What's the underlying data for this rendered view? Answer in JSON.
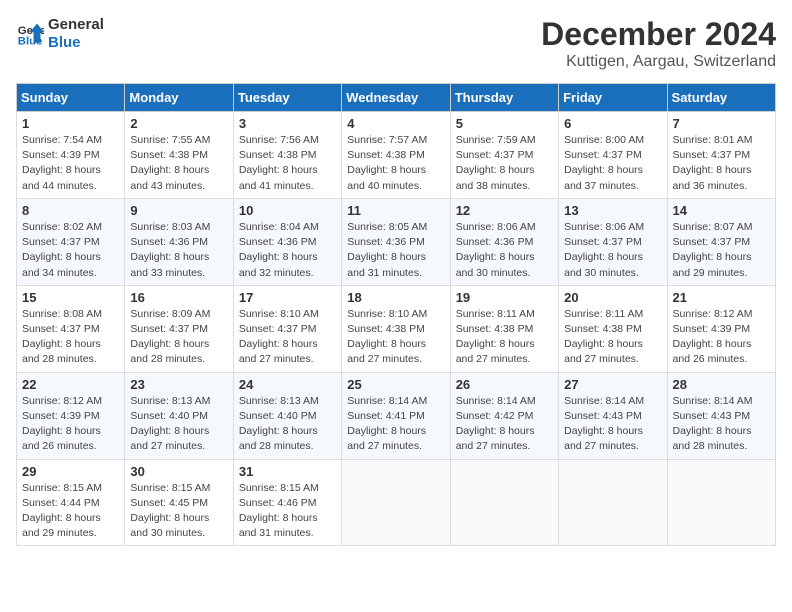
{
  "header": {
    "logo_line1": "General",
    "logo_line2": "Blue",
    "month_title": "December 2024",
    "location": "Kuttigen, Aargau, Switzerland"
  },
  "days_of_week": [
    "Sunday",
    "Monday",
    "Tuesday",
    "Wednesday",
    "Thursday",
    "Friday",
    "Saturday"
  ],
  "weeks": [
    [
      {
        "day": "1",
        "sunrise": "7:54 AM",
        "sunset": "4:39 PM",
        "daylight": "8 hours and 44 minutes."
      },
      {
        "day": "2",
        "sunrise": "7:55 AM",
        "sunset": "4:38 PM",
        "daylight": "8 hours and 43 minutes."
      },
      {
        "day": "3",
        "sunrise": "7:56 AM",
        "sunset": "4:38 PM",
        "daylight": "8 hours and 41 minutes."
      },
      {
        "day": "4",
        "sunrise": "7:57 AM",
        "sunset": "4:38 PM",
        "daylight": "8 hours and 40 minutes."
      },
      {
        "day": "5",
        "sunrise": "7:59 AM",
        "sunset": "4:37 PM",
        "daylight": "8 hours and 38 minutes."
      },
      {
        "day": "6",
        "sunrise": "8:00 AM",
        "sunset": "4:37 PM",
        "daylight": "8 hours and 37 minutes."
      },
      {
        "day": "7",
        "sunrise": "8:01 AM",
        "sunset": "4:37 PM",
        "daylight": "8 hours and 36 minutes."
      }
    ],
    [
      {
        "day": "8",
        "sunrise": "8:02 AM",
        "sunset": "4:37 PM",
        "daylight": "8 hours and 34 minutes."
      },
      {
        "day": "9",
        "sunrise": "8:03 AM",
        "sunset": "4:36 PM",
        "daylight": "8 hours and 33 minutes."
      },
      {
        "day": "10",
        "sunrise": "8:04 AM",
        "sunset": "4:36 PM",
        "daylight": "8 hours and 32 minutes."
      },
      {
        "day": "11",
        "sunrise": "8:05 AM",
        "sunset": "4:36 PM",
        "daylight": "8 hours and 31 minutes."
      },
      {
        "day": "12",
        "sunrise": "8:06 AM",
        "sunset": "4:36 PM",
        "daylight": "8 hours and 30 minutes."
      },
      {
        "day": "13",
        "sunrise": "8:06 AM",
        "sunset": "4:37 PM",
        "daylight": "8 hours and 30 minutes."
      },
      {
        "day": "14",
        "sunrise": "8:07 AM",
        "sunset": "4:37 PM",
        "daylight": "8 hours and 29 minutes."
      }
    ],
    [
      {
        "day": "15",
        "sunrise": "8:08 AM",
        "sunset": "4:37 PM",
        "daylight": "8 hours and 28 minutes."
      },
      {
        "day": "16",
        "sunrise": "8:09 AM",
        "sunset": "4:37 PM",
        "daylight": "8 hours and 28 minutes."
      },
      {
        "day": "17",
        "sunrise": "8:10 AM",
        "sunset": "4:37 PM",
        "daylight": "8 hours and 27 minutes."
      },
      {
        "day": "18",
        "sunrise": "8:10 AM",
        "sunset": "4:38 PM",
        "daylight": "8 hours and 27 minutes."
      },
      {
        "day": "19",
        "sunrise": "8:11 AM",
        "sunset": "4:38 PM",
        "daylight": "8 hours and 27 minutes."
      },
      {
        "day": "20",
        "sunrise": "8:11 AM",
        "sunset": "4:38 PM",
        "daylight": "8 hours and 27 minutes."
      },
      {
        "day": "21",
        "sunrise": "8:12 AM",
        "sunset": "4:39 PM",
        "daylight": "8 hours and 26 minutes."
      }
    ],
    [
      {
        "day": "22",
        "sunrise": "8:12 AM",
        "sunset": "4:39 PM",
        "daylight": "8 hours and 26 minutes."
      },
      {
        "day": "23",
        "sunrise": "8:13 AM",
        "sunset": "4:40 PM",
        "daylight": "8 hours and 27 minutes."
      },
      {
        "day": "24",
        "sunrise": "8:13 AM",
        "sunset": "4:40 PM",
        "daylight": "8 hours and 28 minutes."
      },
      {
        "day": "25",
        "sunrise": "8:14 AM",
        "sunset": "4:41 PM",
        "daylight": "8 hours and 27 minutes."
      },
      {
        "day": "26",
        "sunrise": "8:14 AM",
        "sunset": "4:42 PM",
        "daylight": "8 hours and 27 minutes."
      },
      {
        "day": "27",
        "sunrise": "8:14 AM",
        "sunset": "4:43 PM",
        "daylight": "8 hours and 27 minutes."
      },
      {
        "day": "28",
        "sunrise": "8:14 AM",
        "sunset": "4:43 PM",
        "daylight": "8 hours and 28 minutes."
      }
    ],
    [
      {
        "day": "29",
        "sunrise": "8:15 AM",
        "sunset": "4:44 PM",
        "daylight": "8 hours and 29 minutes."
      },
      {
        "day": "30",
        "sunrise": "8:15 AM",
        "sunset": "4:45 PM",
        "daylight": "8 hours and 30 minutes."
      },
      {
        "day": "31",
        "sunrise": "8:15 AM",
        "sunset": "4:46 PM",
        "daylight": "8 hours and 31 minutes."
      },
      null,
      null,
      null,
      null
    ]
  ],
  "labels": {
    "sunrise": "Sunrise:",
    "sunset": "Sunset:",
    "daylight": "Daylight:"
  }
}
